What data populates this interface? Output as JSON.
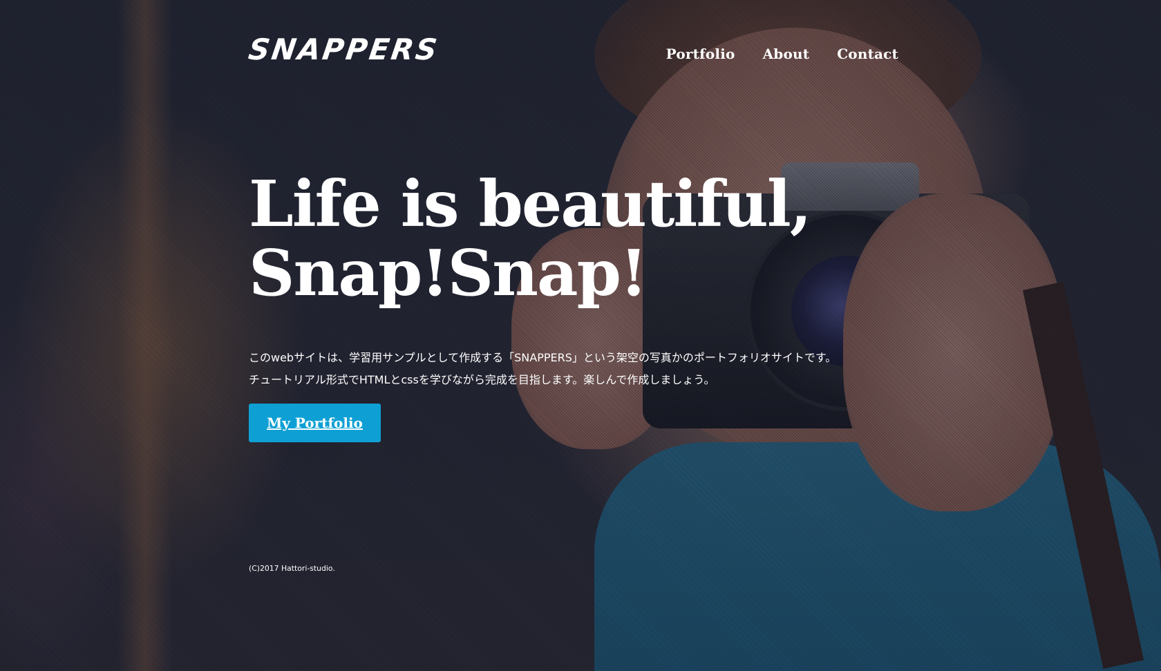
{
  "header": {
    "logo": "SNAPPERS",
    "nav": [
      {
        "label": "Portfolio"
      },
      {
        "label": "About"
      },
      {
        "label": "Contact"
      }
    ]
  },
  "hero": {
    "title_line1": "Life is beautiful,",
    "title_line2": "Snap!Snap!",
    "desc_line1": "このwebサイトは、学習用サンプルとして作成する「SNAPPERS」という架空の写真かのポートフォリオサイトです。",
    "desc_line2": "チュートリアル形式でHTMLとcssを学びながら完成を目指します。楽しんで作成しましょう。",
    "cta_label": "My Portfolio"
  },
  "footer": {
    "copyright": "(C)2017 Hattori-studio."
  },
  "colors": {
    "accent": "#0ea0d4",
    "text": "#ffffff",
    "overlay": "#161a2c"
  },
  "background": {
    "description_icon": "camera-photo-background"
  }
}
